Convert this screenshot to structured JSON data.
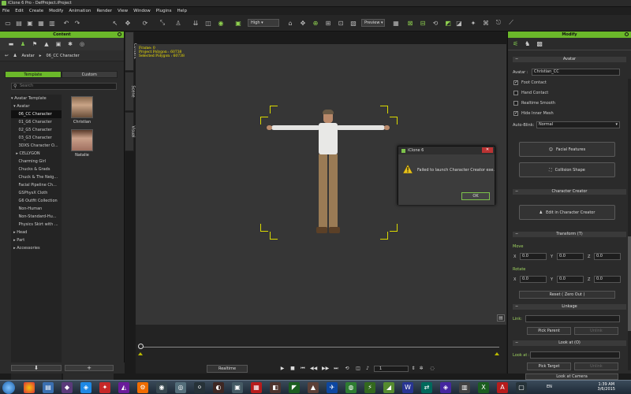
{
  "window": {
    "title": "iClone 6 Pro - DefProject.iProject"
  },
  "menu": [
    "File",
    "Edit",
    "Create",
    "Modify",
    "Animation",
    "Render",
    "View",
    "Window",
    "Plugins",
    "Help"
  ],
  "toolbar": {
    "quality": "High",
    "preview": "Preview"
  },
  "content_panel": {
    "header": "Content",
    "breadcrumb": [
      "Avatar",
      "06_CC Character"
    ],
    "tabs": [
      "Template",
      "Custom"
    ],
    "search_placeholder": "Search",
    "tree": [
      "▾ Avatar Template",
      "  ▾ Avatar",
      "      06_CC Character",
      "      01_G6 Character",
      "      02_G5 Character",
      "      03_G3 Character",
      "      3DXS Character O...",
      "    ▸ CELLYGON",
      "      Charming Girl",
      "      Chucks & Grads",
      "      Chuck & The Neig...",
      "      Facial Pipeline Ch...",
      "      GSPhysX Cloth",
      "      G6 Outfit Collection",
      "      Non-Human",
      "      Non-Standard-Hu...",
      "      Physics Skirt with ...",
      "  ▸ Head",
      "  ▸ Part",
      "  ▸ Accessories"
    ],
    "thumbs": [
      "Christian",
      "Natalie"
    ],
    "footer_down": "⬇",
    "footer_add": "+"
  },
  "side_tabs": [
    "Content",
    "Scene",
    "Visual"
  ],
  "viewport": {
    "info_lines": [
      "Frame: 0",
      "Project Polygon : 60738",
      "Selected Polygon : 60738"
    ]
  },
  "dialog": {
    "title": "iClone 6",
    "close": "✕",
    "message": "Failed to launch Character Creator exe.",
    "ok": "OK"
  },
  "timeline": {
    "realtime": "Realtime",
    "frame": "1"
  },
  "modify_panel": {
    "header": "Modify",
    "avatar_section": "Avatar",
    "avatar_label": "Avatar :",
    "avatar_name": "Christian_CC",
    "checkboxes": [
      {
        "label": "Foot Contact",
        "checked": true
      },
      {
        "label": "Hand Contact",
        "checked": false
      },
      {
        "label": "Realtime Smooth",
        "checked": false
      },
      {
        "label": "Hide Inner Mesh",
        "checked": true
      }
    ],
    "auto_blink_label": "Auto-Blink:",
    "auto_blink_value": "Normal",
    "facial_features": "Facial Features",
    "collision_shape": "Collision Shape",
    "cc_section": "Character Creator",
    "edit_in_cc": "Edit in Character Creator",
    "transform_section": "Transform  (T)",
    "move_label": "Move",
    "rotate_label": "Rotate",
    "axis_x": "X",
    "axis_y": "Y",
    "axis_z": "Z",
    "move_x": "0.0",
    "move_y": "0.0",
    "move_z": "0.0",
    "rot_x": "0.0",
    "rot_y": "0.0",
    "rot_z": "0.0",
    "reset": "Reset ( Zero Out )",
    "linkage_section": "Linkage",
    "link_label": "Link:",
    "pick_parent": "Pick Parent",
    "unlink": "Unlink",
    "lookat_section": "Look at  (O)",
    "lookat_label": "Look at :",
    "pick_target": "Pick Target",
    "unlink2": "Unlink",
    "look_at_camera": "Look at Camera"
  },
  "taskbar": {
    "time": "1:39 AM",
    "date": "3/6/2015",
    "lang": "EN"
  },
  "colors": {
    "accent": "#6bb82a",
    "warning": "#e8c21c"
  }
}
